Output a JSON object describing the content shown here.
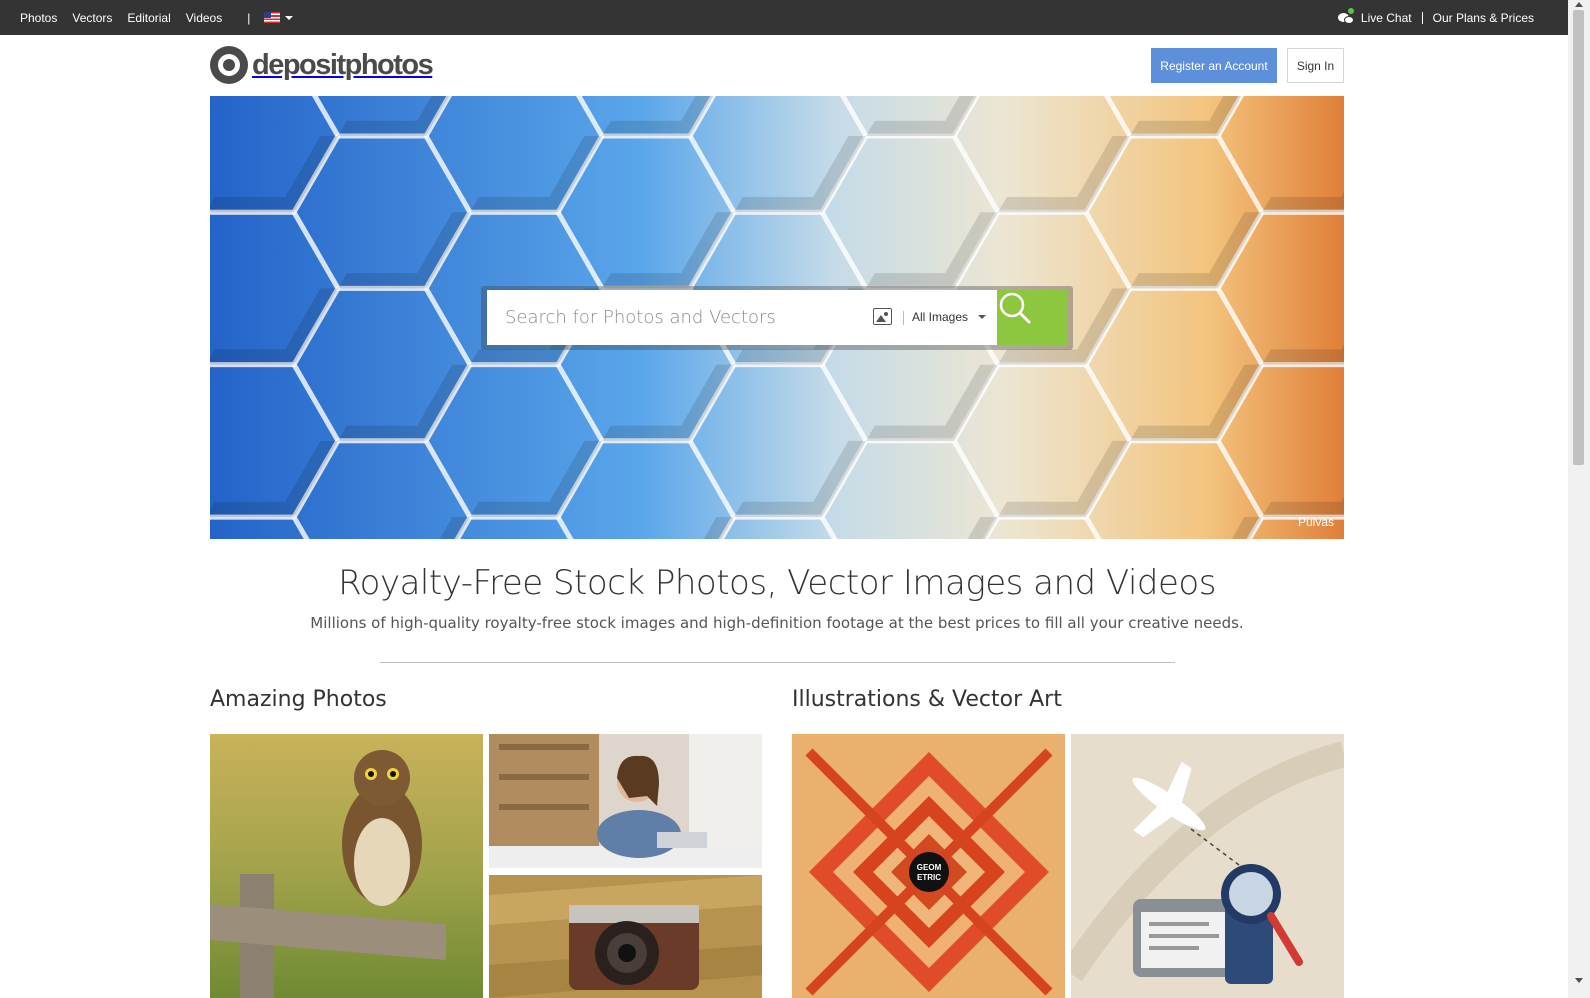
{
  "topbar": {
    "nav": [
      "Photos",
      "Vectors",
      "Editorial",
      "Videos"
    ],
    "separator": "|",
    "language_icon": "us-flag-icon",
    "live_chat": "Live Chat",
    "plans": "Our Plans & Prices"
  },
  "header": {
    "logo_text": "depositphotos",
    "register": "Register an Account",
    "signin": "Sign In"
  },
  "hero": {
    "credit": "Pulvas",
    "search_placeholder": "Search for Photos and Vectors",
    "search_type": "All Images",
    "search_button_icon": "magnifier-icon"
  },
  "intro": {
    "title": "Royalty-Free Stock Photos, Vector Images and Videos",
    "subtitle": "Millions of high-quality royalty-free stock images and high-definition footage at the best prices to fill all your creative needs."
  },
  "sections": {
    "photos": "Amazing Photos",
    "vectors": "Illustrations & Vector Art",
    "badge_text": "GEOM ETRIC"
  },
  "colors": {
    "accent_blue": "#5d8fda",
    "search_green": "#8dc63f",
    "topbar": "#343434"
  }
}
